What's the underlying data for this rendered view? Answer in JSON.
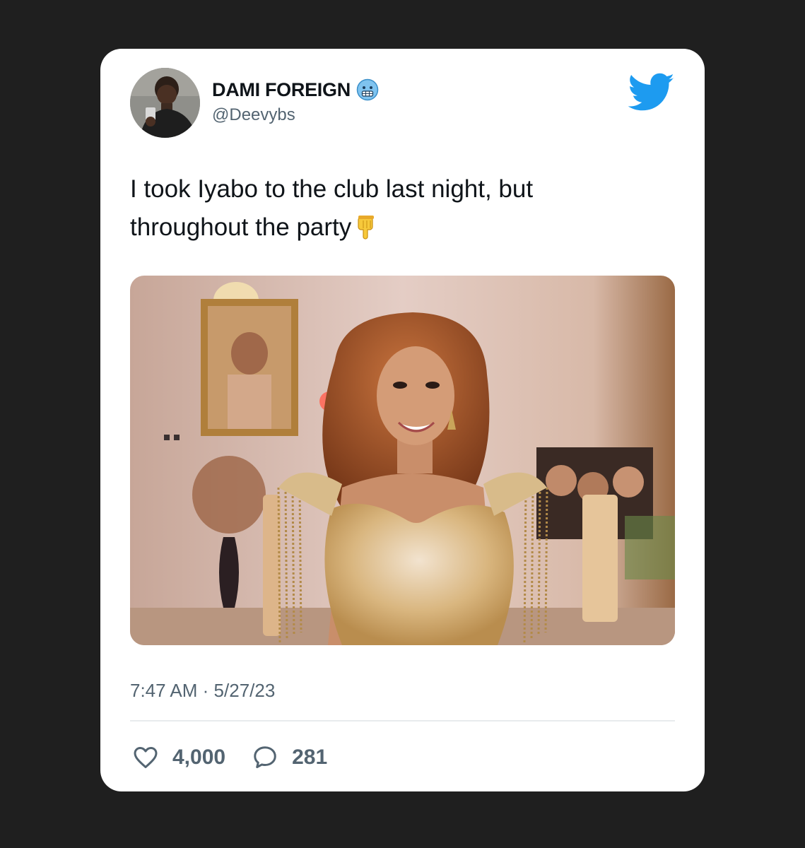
{
  "tweet": {
    "author": {
      "display_name": "DAMI FOREIGN",
      "handle": "@Deevybs",
      "name_emoji": "cold-face-emoji-icon"
    },
    "text_line1": "I took Iyabo to the club last night, but",
    "text_line2": "throughout the party",
    "text_emoji": "backhand-index-pointing-down-emoji-icon",
    "time": "7:47 AM",
    "separator": "·",
    "date": "5/27/23",
    "likes": "4,000",
    "replies": "281"
  },
  "colors": {
    "page_background": "#1f1f1f",
    "card_background": "#ffffff",
    "twitter_blue": "#1d9bf0",
    "primary_text": "#0f1419",
    "secondary_text": "#536471"
  },
  "icons": [
    "twitter-bird-icon",
    "heart-icon",
    "comment-icon"
  ]
}
